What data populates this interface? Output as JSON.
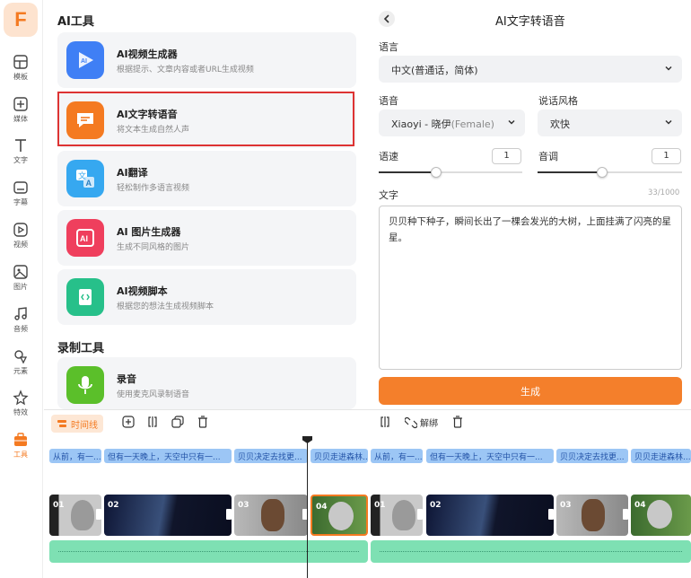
{
  "rail": {
    "logo": "F",
    "items": [
      {
        "label": "模板",
        "icon": "template-icon"
      },
      {
        "label": "媒体",
        "icon": "media-icon"
      },
      {
        "label": "文字",
        "icon": "text-icon"
      },
      {
        "label": "字幕",
        "icon": "subtitle-icon"
      },
      {
        "label": "视频",
        "icon": "video-icon"
      },
      {
        "label": "图片",
        "icon": "image-icon"
      },
      {
        "label": "音频",
        "icon": "audio-icon"
      },
      {
        "label": "元素",
        "icon": "elements-icon"
      },
      {
        "label": "特效",
        "icon": "effects-icon"
      },
      {
        "label": "工具",
        "icon": "tools-icon"
      }
    ],
    "active": "工具"
  },
  "tools": {
    "ai_section": "AI工具",
    "cards": [
      {
        "title": "AI视频生成器",
        "desc": "根据提示、文章内容或者URL生成视频",
        "icon": "ai-video-icon",
        "color": "#3f7ff5"
      },
      {
        "title": "AI文字转语音",
        "desc": "将文本生成自然人声",
        "icon": "text-to-speech-icon",
        "color": "#f47a21"
      },
      {
        "title": "AI翻译",
        "desc": "轻松制作多语言视频",
        "icon": "translate-icon",
        "color": "#36a8f0"
      },
      {
        "title": "AI 图片生成器",
        "desc": "生成不同风格的图片",
        "icon": "ai-image-icon",
        "color": "#ef3f5d"
      },
      {
        "title": "AI视频脚本",
        "desc": "根据您的想法生成视频脚本",
        "icon": "script-icon",
        "color": "#27c08a"
      }
    ],
    "record_section": "录制工具",
    "record_card": {
      "title": "录音",
      "desc": "使用麦克风录制语音",
      "icon": "microphone-icon",
      "color": "#5bbf2a"
    }
  },
  "tts": {
    "title": "AI文字转语音",
    "language_label": "语言",
    "language_value": "中文(普通话，简体)",
    "voice_label": "语音",
    "voice_value": "Xiaoyi - 晓伊",
    "voice_gender": "(Female)",
    "style_label": "说话风格",
    "style_value": "欢快",
    "speed_label": "语速",
    "speed_value": "1",
    "speed_level": 0.4,
    "pitch_label": "音调",
    "pitch_value": "1",
    "pitch_level": 0.45,
    "text_label": "文字",
    "char_count": "33/1000",
    "text_value": "贝贝种下种子，瞬间长出了一棵会发光的大树，上面挂满了闪亮的星星。",
    "generate_label": "生成"
  },
  "timeline": {
    "mode_label": "时间线",
    "unlink_label": "解绑",
    "subtitles": [
      "从前，有一...",
      "但有一天晚上，天空中只有一...",
      "贝贝决定去找更...",
      "贝贝走进森林..."
    ],
    "clips": [
      "01",
      "02",
      "03",
      "04"
    ],
    "accent": "#f47a21"
  }
}
